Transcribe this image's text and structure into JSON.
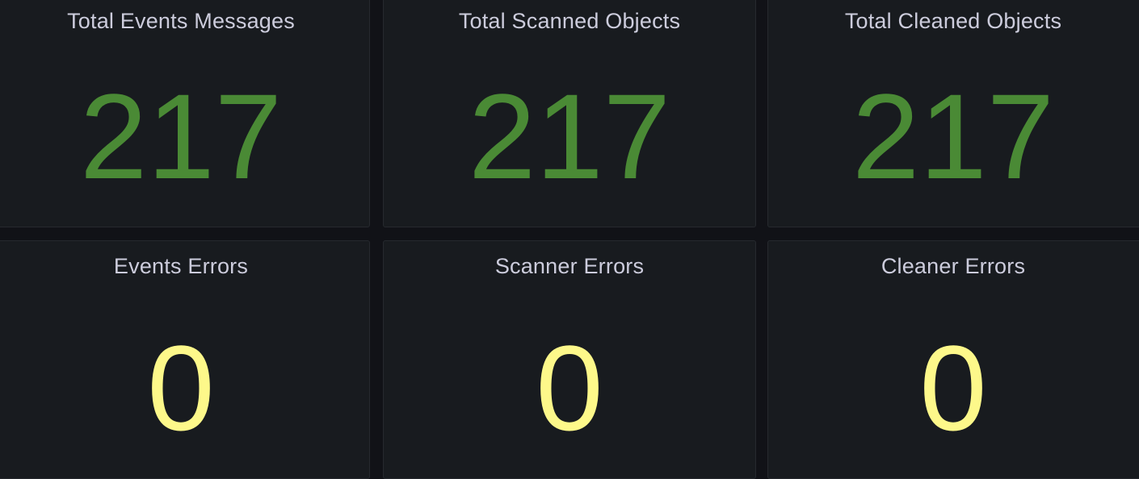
{
  "colors": {
    "ok": "#4a8a35",
    "warn": "#fdf88a"
  },
  "panels": [
    {
      "title": "Total Events Messages",
      "value": "217"
    },
    {
      "title": "Total Scanned Objects",
      "value": "217"
    },
    {
      "title": "Total Cleaned Objects",
      "value": "217"
    },
    {
      "title": "Events Errors",
      "value": "0"
    },
    {
      "title": "Scanner Errors",
      "value": "0"
    },
    {
      "title": "Cleaner Errors",
      "value": "0"
    }
  ]
}
